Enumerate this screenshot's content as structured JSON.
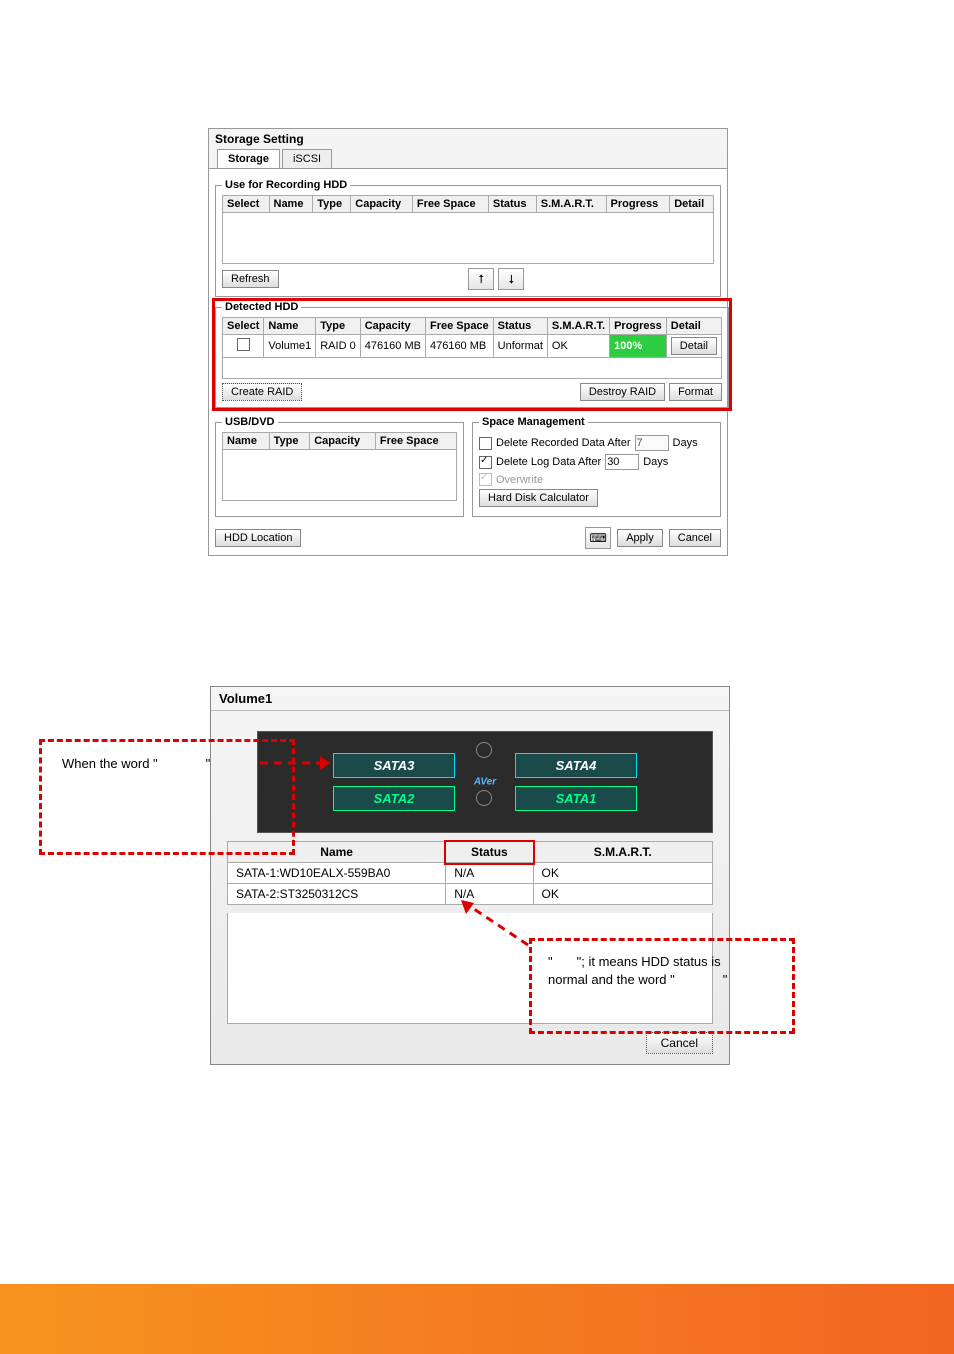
{
  "storage_setting": {
    "title": "Storage Setting",
    "tabs": {
      "storage": "Storage",
      "iscsi": "iSCSI"
    },
    "recording": {
      "legend": "Use for Recording HDD",
      "cols": [
        "Select",
        "Name",
        "Type",
        "Capacity",
        "Free Space",
        "Status",
        "S.M.A.R.T.",
        "Progress",
        "Detail"
      ],
      "refresh": "Refresh"
    },
    "detected": {
      "legend": "Detected HDD",
      "cols": [
        "Select",
        "Name",
        "Type",
        "Capacity",
        "Free Space",
        "Status",
        "S.M.A.R.T.",
        "Progress",
        "Detail"
      ],
      "rows": [
        {
          "select": "",
          "name": "Volume1",
          "type": "RAID 0",
          "capacity": "476160 MB",
          "freespace": "476160 MB",
          "status": "Unformat",
          "smart": "OK",
          "progress": "100%",
          "detail": "Detail"
        }
      ],
      "create_raid": "Create RAID",
      "destroy_raid": "Destroy RAID",
      "format": "Format"
    },
    "usbdvd": {
      "legend": "USB/DVD",
      "cols": [
        "Name",
        "Type",
        "Capacity",
        "Free Space"
      ]
    },
    "space_mgmt": {
      "legend": "Space Management",
      "delete_rec_label": "Delete Recorded Data After",
      "delete_rec_days": "7",
      "delete_log_label": "Delete Log Data After",
      "delete_log_days": "30",
      "days_label": "Days",
      "overwrite_label": "Overwrite",
      "hdcalc": "Hard Disk Calculator"
    },
    "hdd_location": "HDD Location",
    "apply": "Apply",
    "cancel": "Cancel"
  },
  "volume1": {
    "title": "Volume1",
    "slots": {
      "sata1": "SATA1",
      "sata2": "SATA2",
      "sata3": "SATA3",
      "sata4": "SATA4"
    },
    "center": "AVer",
    "cols": [
      "Name",
      "Status",
      "S.M.A.R.T."
    ],
    "rows": [
      {
        "name": "SATA-1:WD10EALX-559BA0",
        "status": "N/A",
        "smart": "OK"
      },
      {
        "name": "SATA-2:ST3250312CS",
        "status": "N/A",
        "smart": "OK"
      }
    ],
    "cancel": "Cancel"
  },
  "callouts": {
    "left_pre": "When the word \"",
    "left_post": "\"",
    "right_1_pre": "\"",
    "right_1_post": "\"; it means HDD status is",
    "right_2_pre": "normal and the word \"",
    "right_2_post": "\""
  }
}
